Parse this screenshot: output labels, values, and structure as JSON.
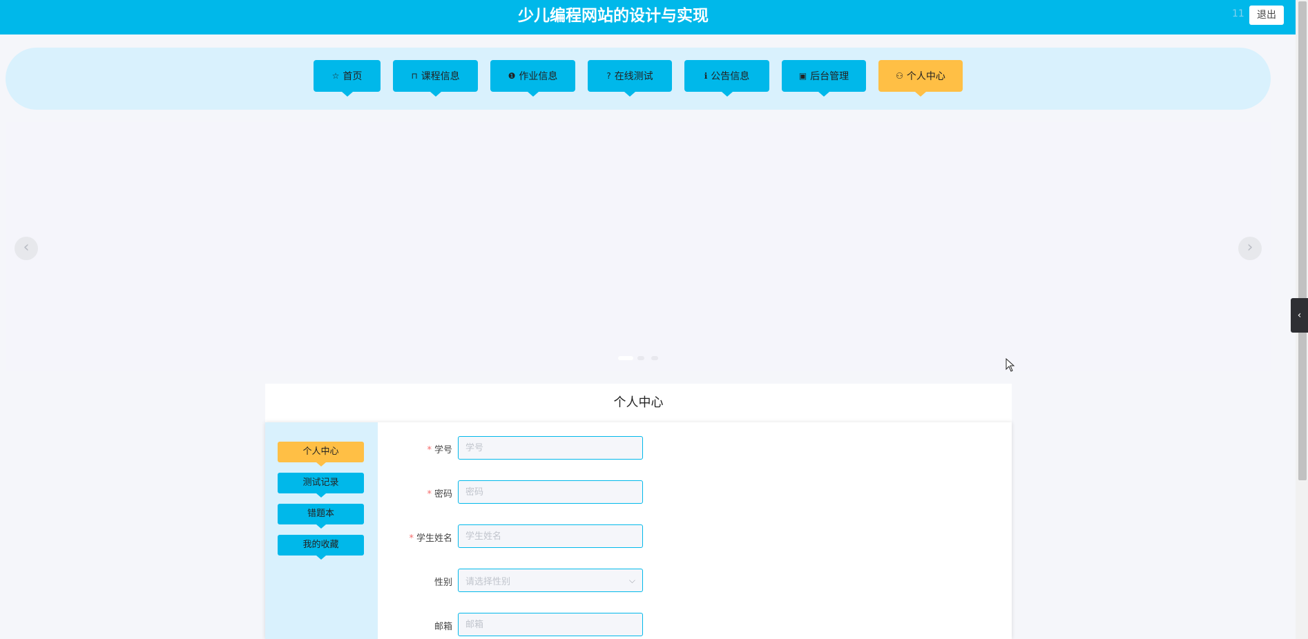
{
  "header": {
    "title": "少儿编程网站的设计与实现",
    "user": "11",
    "logout_label": "退出"
  },
  "nav": {
    "items": [
      {
        "icon": "☆",
        "label": "首页"
      },
      {
        "icon": "⊓",
        "label": "课程信息"
      },
      {
        "icon": "❶",
        "label": "作业信息"
      },
      {
        "icon": "?",
        "label": "在线测试"
      },
      {
        "icon": "ℹ",
        "label": "公告信息"
      },
      {
        "icon": "▣",
        "label": "后台管理"
      },
      {
        "icon": "⚇",
        "label": "个人中心"
      }
    ],
    "active_index": 6
  },
  "carousel": {
    "prev_icon": "‹",
    "next_icon": "›",
    "dot_count": 3,
    "active_dot": 0
  },
  "side_toggle_icon": "‹",
  "center": {
    "title": "个人中心",
    "subnav": [
      "个人中心",
      "测试记录",
      "错题本",
      "我的收藏"
    ],
    "active_sub": 0
  },
  "form": {
    "fields": [
      {
        "label": "学号",
        "required": true,
        "placeholder": "学号",
        "value": ""
      },
      {
        "label": "密码",
        "required": true,
        "placeholder": "密码",
        "value": ""
      },
      {
        "label": "学生姓名",
        "required": true,
        "placeholder": "学生姓名",
        "value": ""
      },
      {
        "label": "性别",
        "required": false,
        "placeholder": "请选择性别",
        "type": "select",
        "value": ""
      },
      {
        "label": "邮箱",
        "required": false,
        "placeholder": "邮箱",
        "value": ""
      }
    ]
  },
  "colors": {
    "primary": "#00b8ea",
    "accent": "#ffbf45",
    "nav_band": "#d9f1fd"
  }
}
